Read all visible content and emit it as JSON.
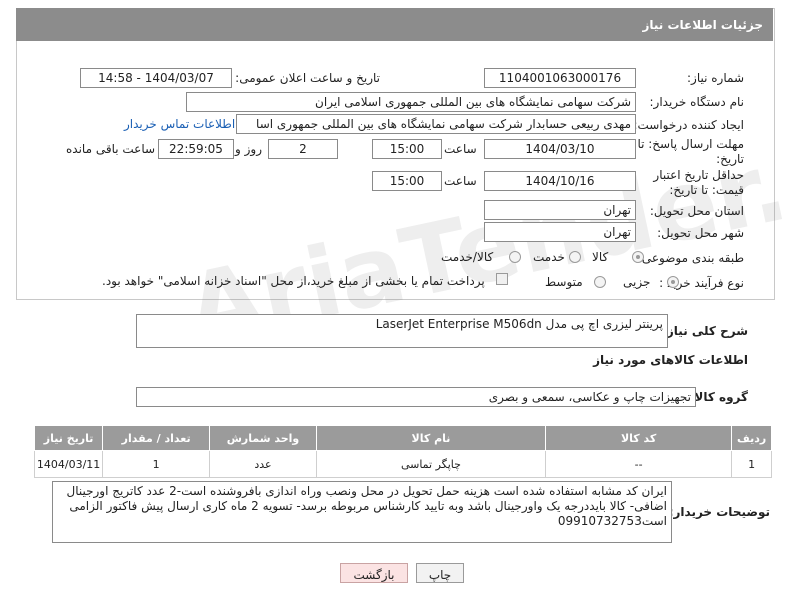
{
  "header": {
    "title": "جزئیات اطلاعات نیاز"
  },
  "form": {
    "need_number": {
      "label": "شماره نیاز:",
      "value": "1104001063000176"
    },
    "announce_datetime": {
      "label": "تاریخ و ساعت اعلان عمومی:",
      "value": "1404/03/07 - 14:58"
    },
    "buyer_org": {
      "label": "نام دستگاه خریدار:",
      "value": "شرکت سهامی نمایشگاه های بین المللی جمهوری اسلامی ایران"
    },
    "requester": {
      "label": "ایجاد کننده درخواست:",
      "value": "مهدی  ربیعی حسابدار شرکت سهامی نمایشگاه های بین المللی جمهوری اسا",
      "contact_link": "اطلاعات تماس خریدار"
    },
    "reply_deadline": {
      "label": "مهلت ارسال پاسخ: تا تاریخ:",
      "date": "1404/03/10",
      "time_label": "ساعت",
      "time": "15:00",
      "days": "2",
      "days_label": "روز و",
      "remaining": "22:59:05",
      "remaining_label": "ساعت باقی مانده"
    },
    "price_validity": {
      "label": "حداقل تاریخ اعتبار قیمت: تا تاریخ:",
      "date": "1404/10/16",
      "time_label": "ساعت",
      "time": "15:00"
    },
    "delivery_province": {
      "label": "استان محل تحویل:",
      "value": "تهران"
    },
    "delivery_city": {
      "label": "شهر محل تحویل:",
      "value": "تهران"
    },
    "category": {
      "label": "طبقه بندی موضوعی:",
      "options": [
        "کالا",
        "خدمت",
        "کالا/خدمت"
      ],
      "selected": "کالا"
    },
    "process_type": {
      "label": "نوع فرآیند خرید :",
      "options": [
        "جزیی",
        "متوسط"
      ],
      "selected": "جزیی",
      "payment_note": "پرداخت تمام یا بخشی از مبلغ خرید،از محل \"اسناد خزانه اسلامی\" خواهد بود."
    }
  },
  "general_desc": {
    "label": "شرح کلی نیاز:",
    "value": "پرینتر لیزری اچ پی مدل LaserJet Enterprise M506dn"
  },
  "goods_section": {
    "title": "اطلاعات کالاهای مورد نیاز"
  },
  "goods_group": {
    "label": "گروه کالا:",
    "value": "تجهیزات چاپ و عکاسی، سمعی و بصری"
  },
  "table": {
    "headers": [
      "ردیف",
      "کد کالا",
      "نام کالا",
      "واحد شمارش",
      "تعداد / مقدار",
      "تاریخ نیاز"
    ],
    "rows": [
      [
        "1",
        "--",
        "چاپگر تماسی",
        "عدد",
        "1",
        "1404/03/11"
      ]
    ]
  },
  "buyer_notes": {
    "label": "توضیحات خریدار:",
    "value": "ایران کد مشابه استفاده شده است هزینه حمل تحویل در محل ونصب وراه اندازی  بافروشنده است-2 عدد کاتریج اورجینال اضافی- کالا بایددرجه یک واورجینال باشد وبه تایید کارشناس مربوطه برسد- تسویه 2 ماه کاری ارسال پیش فاکتور الزامی است09910732753"
  },
  "buttons": {
    "print": "چاپ",
    "back": "بازگشت"
  },
  "watermark": "AriaTender.neT"
}
